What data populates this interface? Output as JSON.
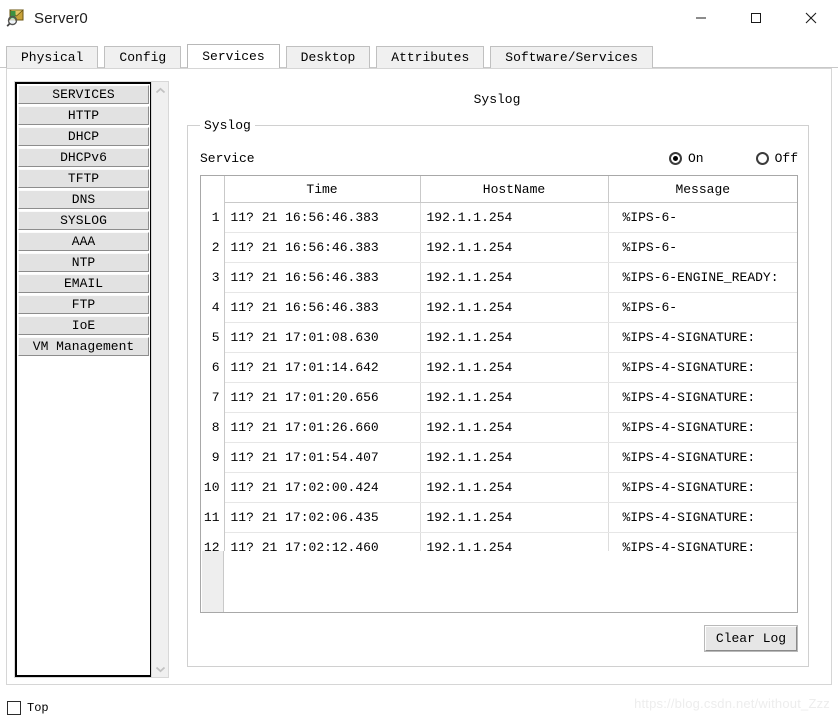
{
  "window": {
    "title": "Server0",
    "icon": "server-inspect-icon",
    "controls": {
      "minimize": "minimize-icon",
      "maximize": "maximize-icon",
      "close": "close-icon"
    }
  },
  "tabs": [
    {
      "label": "Physical",
      "active": false
    },
    {
      "label": "Config",
      "active": false
    },
    {
      "label": "Services",
      "active": true
    },
    {
      "label": "Desktop",
      "active": false
    },
    {
      "label": "Attributes",
      "active": false
    },
    {
      "label": "Software/Services",
      "active": false
    }
  ],
  "sidebar": {
    "scroll_up_icon": "chevron-up-icon",
    "scroll_down_icon": "chevron-down-icon",
    "items": [
      {
        "label": "SERVICES"
      },
      {
        "label": "HTTP"
      },
      {
        "label": "DHCP"
      },
      {
        "label": "DHCPv6"
      },
      {
        "label": "TFTP"
      },
      {
        "label": "DNS"
      },
      {
        "label": "SYSLOG"
      },
      {
        "label": "AAA"
      },
      {
        "label": "NTP"
      },
      {
        "label": "EMAIL"
      },
      {
        "label": "FTP"
      },
      {
        "label": "IoE"
      },
      {
        "label": "VM Management"
      }
    ]
  },
  "main": {
    "page_title": "Syslog",
    "fieldset_legend": "Syslog",
    "service_label": "Service",
    "radio_on": "On",
    "radio_off": "Off",
    "service_state": "On",
    "clear_log_label": "Clear Log",
    "table": {
      "columns": [
        "",
        "Time",
        "HostName",
        "Message"
      ],
      "rows": [
        {
          "num": "1",
          "time": "11? 21 16:56:46.383",
          "host": "192.1.1.254",
          "message": "%IPS-6-"
        },
        {
          "num": "2",
          "time": "11? 21 16:56:46.383",
          "host": "192.1.1.254",
          "message": "%IPS-6-"
        },
        {
          "num": "3",
          "time": "11? 21 16:56:46.383",
          "host": "192.1.1.254",
          "message": "%IPS-6-ENGINE_READY:"
        },
        {
          "num": "4",
          "time": "11? 21 16:56:46.383",
          "host": "192.1.1.254",
          "message": "%IPS-6-"
        },
        {
          "num": "5",
          "time": "11? 21 17:01:08.630",
          "host": "192.1.1.254",
          "message": "%IPS-4-SIGNATURE:"
        },
        {
          "num": "6",
          "time": "11? 21 17:01:14.642",
          "host": "192.1.1.254",
          "message": "%IPS-4-SIGNATURE:"
        },
        {
          "num": "7",
          "time": "11? 21 17:01:20.656",
          "host": "192.1.1.254",
          "message": "%IPS-4-SIGNATURE:"
        },
        {
          "num": "8",
          "time": "11? 21 17:01:26.660",
          "host": "192.1.1.254",
          "message": "%IPS-4-SIGNATURE:"
        },
        {
          "num": "9",
          "time": "11? 21 17:01:54.407",
          "host": "192.1.1.254",
          "message": "%IPS-4-SIGNATURE:"
        },
        {
          "num": "10",
          "time": "11? 21 17:02:00.424",
          "host": "192.1.1.254",
          "message": "%IPS-4-SIGNATURE:"
        },
        {
          "num": "11",
          "time": "11? 21 17:02:06.435",
          "host": "192.1.1.254",
          "message": "%IPS-4-SIGNATURE:"
        },
        {
          "num": "12",
          "time": "11? 21 17:02:12.460",
          "host": "192.1.1.254",
          "message": "%IPS-4-SIGNATURE:"
        }
      ]
    }
  },
  "statusbar": {
    "top_label": "Top",
    "top_checked": false,
    "watermark": "https://blog.csdn.net/without_Zzz"
  },
  "colors": {
    "window_bg": "#ffffff",
    "button_face": "#e2e2e2",
    "tab_inactive": "#f0f0f0",
    "border_dark": "#000000",
    "grid_line": "#dddddd",
    "watermark": "#ededed"
  }
}
